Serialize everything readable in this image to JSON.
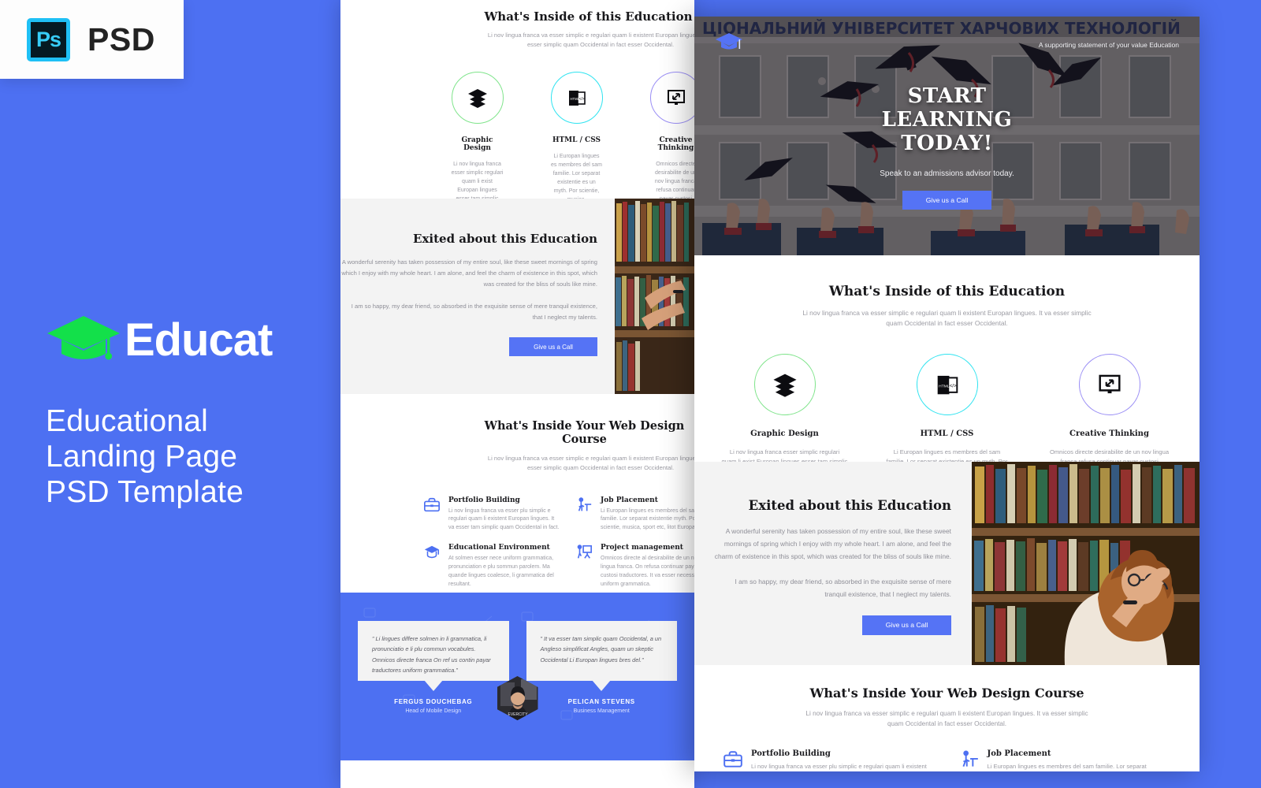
{
  "badge": {
    "app_icon_label": "Ps",
    "label": "PSD"
  },
  "promo": {
    "logo_icon": "graduation-cap-icon",
    "logo_text": "Educat",
    "title_lines": [
      "Educational",
      "Landing Page",
      "PSD Template"
    ],
    "accent_green": "#13e04a",
    "background": "#4d70f2"
  },
  "template": {
    "hero": {
      "logo_icon": "graduation-cap-icon",
      "nav_note": "A supporting statement of your value Education",
      "headline_lines": [
        "START",
        "LEARNING",
        "TODAY!"
      ],
      "subhead": "Speak to an admissions advisor today.",
      "cta_label": "Give us a Call",
      "cta_color": "#5573f5"
    },
    "inside_education": {
      "heading": "What's Inside of this Education",
      "lead": "Li nov lingua franca va esser simplic e regulari quam li existent Europan lingues. It va esser simplic quam Occidental in fact  esser Occidental.",
      "cards": [
        {
          "icon": "layers-icon",
          "ring_color": "#7fe48b",
          "title": "Graphic Design",
          "desc": "Li nov lingua franca  esser  simplic regulari quam li exist Europan lingues esser tam simplic quam."
        },
        {
          "icon": "html-file-icon",
          "ring_color": "#2ee3f0",
          "title": "HTML / CSS",
          "desc": "Li Europan lingues es membres del sam familie. Lor separat existentie es un myth. Por scientie, musica."
        },
        {
          "icon": "monitor-arrows-icon",
          "ring_color": "#9a8ef5",
          "title": "Creative Thinking",
          "desc": "Omnicos directe desirabilite de un nov lingua franca refusa continuar payar custosi traductores."
        }
      ]
    },
    "exited": {
      "heading": "Exited about this Education",
      "paragraph_1": "A wonderful serenity has taken possession of my entire soul, like these sweet mornings of spring which I enjoy with my whole heart. I am alone, and feel the charm of existence in this spot, which was created for the bliss of souls like mine.",
      "paragraph_2": "I am so happy, my dear friend, so absorbed in the exquisite sense of mere tranquil existence, that I neglect my talents.",
      "cta_label": "Give us a Call",
      "photo_alt": "woman-browsing-library-bookshelf"
    },
    "web_design_course": {
      "heading": "What's Inside Your Web Design Course",
      "lead": "Li nov lingua franca va esser simplic e regulari quam li existent Europan lingues. It va esser simplic quam Occidental in fact  esser Occidental.",
      "features": [
        {
          "icon": "briefcase-icon",
          "title": "Portfolio Building",
          "desc": "Li nov lingua franca va esser plu simplic e regulari quam li existent Europan lingues. It va esser tam simplic quam Occidental in fact."
        },
        {
          "icon": "person-at-desk-icon",
          "title": "Job Placement",
          "desc": "Li Europan lingues es membres del sam familie. Lor separat existentie  myth. Por scientie, musica, sport etc, litot Europa us."
        },
        {
          "icon": "graduation-cap-icon",
          "title": "Educational Environment",
          "desc": "At solmen esser nece uniform grammatica, pronunciation e plu sommun parolem. Ma quande lingues coalesce, li grammatica del resultant."
        },
        {
          "icon": "presenter-board-icon",
          "title": "Project management",
          "desc": "Omnicos directe al desirabilite de un nov lingua franca. On refusa continuar payar custosi traductores. It va esser necessi  uniform grammatica."
        }
      ]
    },
    "testimonials": [
      {
        "quote": "” Li lingues differe solmen in li grammatica, li pronunciatio e li plu commun vocabules. Omnicos directe franca On ref us contin payar traductores uniform grammatica.”",
        "name": "FERGUS DOUCHEBAG",
        "role": "Head of Mobile Design",
        "avatar": "portrait-avatar"
      },
      {
        "quote": "” It va esser tam simplic quam Occidental, a un Angleso simplificat Angles, quam un skeptic Occidental Li Europan lingues bres del.”",
        "name": "PELICAN STEVENS",
        "role": "Business Management",
        "avatar": "portrait-avatar"
      }
    ]
  }
}
